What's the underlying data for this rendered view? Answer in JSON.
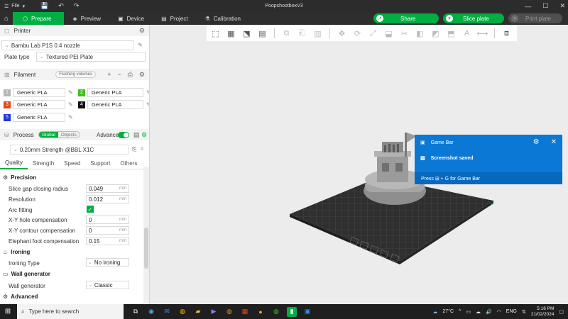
{
  "window": {
    "menu_label": "File",
    "title": "PoopshootboxV3"
  },
  "tabs": [
    {
      "label": "Prepare"
    },
    {
      "label": "Preview"
    },
    {
      "label": "Device"
    },
    {
      "label": "Project"
    },
    {
      "label": "Calibration"
    }
  ],
  "actions": {
    "share": "Share",
    "slice": "Slice plate",
    "print": "Print plate"
  },
  "printer": {
    "section": "Printer",
    "name": "Bambu Lab P1S 0.4 nozzle",
    "plate_type_label": "Plate type",
    "plate_type": "Textured PEI Plate"
  },
  "filament": {
    "section": "Filament",
    "flushing": "Flushing volumes",
    "items": [
      {
        "num": "1",
        "name": "Generic PLA",
        "color": "#b5b5b5"
      },
      {
        "num": "2",
        "name": "Generic PLA",
        "color": "#3ec21a"
      },
      {
        "num": "3",
        "name": "Generic PLA",
        "color": "#e04a1c"
      },
      {
        "num": "4",
        "name": "Generic PLA",
        "color": "#111111"
      },
      {
        "num": "5",
        "name": "Generic PLA",
        "color": "#2233dd"
      }
    ]
  },
  "process": {
    "section": "Process",
    "global": "Global",
    "objects": "Objects",
    "advance": "Advance",
    "profile": "0.20mm Strength @BBL X1C",
    "subtabs": [
      "Quality",
      "Strength",
      "Speed",
      "Support",
      "Others"
    ]
  },
  "precision": {
    "title": "Precision",
    "rows": [
      {
        "label": "Slice gap closing radius",
        "value": "0.049",
        "unit": "mm"
      },
      {
        "label": "Resolution",
        "value": "0.012",
        "unit": "mm"
      },
      {
        "label": "Arc fitting"
      },
      {
        "label": "X-Y hole compensation",
        "value": "0",
        "unit": "mm"
      },
      {
        "label": "X-Y contour compensation",
        "value": "0",
        "unit": "mm"
      },
      {
        "label": "Elephant foot compensation",
        "value": "0.15",
        "unit": "mm"
      }
    ]
  },
  "ironing": {
    "title": "Ironing",
    "type_label": "Ironing Type",
    "type_value": "No ironing"
  },
  "wall": {
    "title": "Wall generator",
    "label": "Wall generator",
    "value": "Classic"
  },
  "advanced": {
    "title": "Advanced"
  },
  "gamebar": {
    "title": "Game Bar",
    "message": "Screenshot saved",
    "hint": "Press ⊞ + G for Game Bar"
  },
  "taskbar": {
    "search_placeholder": "Type here to search",
    "weather": "27°C",
    "lang": "ENG",
    "time": "5:16 PM",
    "date": "21/02/2024"
  }
}
